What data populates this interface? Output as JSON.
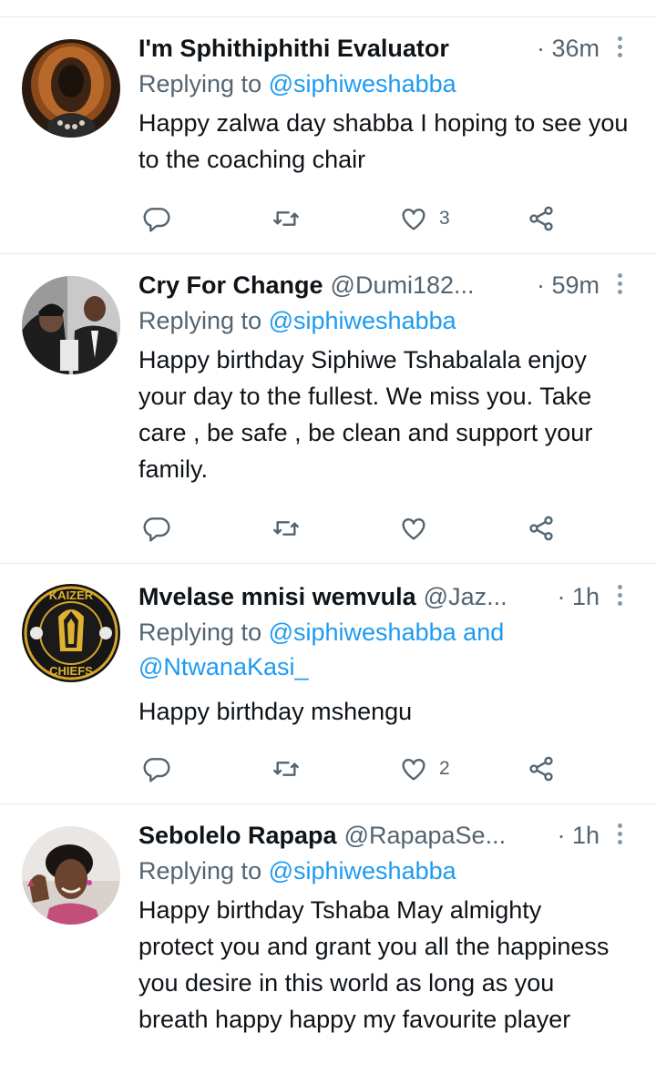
{
  "tweets": [
    {
      "name": "I'm Sphithiphithi Evaluator",
      "handle": "",
      "time": "· 36m",
      "replying_label": "Replying to",
      "mentions": [
        "@siphiweshabba"
      ],
      "mention_joiner": "",
      "body": "Happy zalwa day shabba I hoping to see you to the coaching chair",
      "likes": "3"
    },
    {
      "name": "Cry For Change",
      "handle": "@Dumi182...",
      "time": "· 59m",
      "replying_label": "Replying to",
      "mentions": [
        "@siphiweshabba"
      ],
      "mention_joiner": "",
      "body": "Happy birthday Siphiwe Tshabalala enjoy your day to the fullest.  We miss you.  Take care , be safe , be clean and support your family.",
      "likes": ""
    },
    {
      "name": "Mvelase mnisi wemvula",
      "handle": "@Jaz...",
      "time": "· 1h",
      "replying_label": "Replying to",
      "mentions": [
        "@siphiweshabba",
        "@NtwanaKasi_"
      ],
      "mention_joiner": "and",
      "body": "Happy birthday mshengu",
      "likes": "2"
    },
    {
      "name": "Sebolelo Rapapa",
      "handle": "@RapapaSe...",
      "time": "· 1h",
      "replying_label": "Replying to",
      "mentions": [
        "@siphiweshabba"
      ],
      "mention_joiner": "",
      "body": "Happy birthday Tshaba May almighty protect you and grant you all the happiness you desire in this world as long as you breath happy happy my favourite player",
      "likes": ""
    }
  ],
  "avatars": [
    "lion-avatar",
    "people-photo-avatar",
    "kaizer-chiefs-logo-avatar",
    "woman-avatar"
  ],
  "logo_text": "KAIZER CHIEFS",
  "icons": {
    "reply": "reply-icon",
    "retweet": "retweet-icon",
    "like": "heart-icon",
    "share": "share-icon",
    "more": "more-icon"
  },
  "colors": {
    "text": "#0f1419",
    "secondary": "#536471",
    "link": "#1d9bf0",
    "divider": "#e6e9ec"
  }
}
